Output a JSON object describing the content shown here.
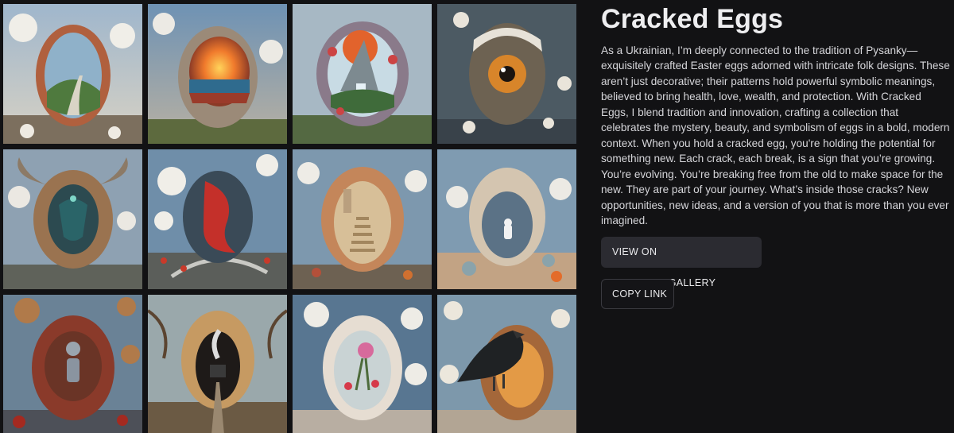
{
  "gallery": {
    "tiles": [
      {
        "icon": "egg-landscape-path-image"
      },
      {
        "icon": "egg-sunset-image"
      },
      {
        "icon": "egg-waterfall-image"
      },
      {
        "icon": "egg-eye-image"
      },
      {
        "icon": "egg-horned-bull-image"
      },
      {
        "icon": "egg-red-swirl-image"
      },
      {
        "icon": "egg-staircase-image"
      },
      {
        "icon": "egg-astronaut-image"
      },
      {
        "icon": "egg-figure-image"
      },
      {
        "icon": "egg-train-tunnel-image"
      },
      {
        "icon": "egg-orchid-image"
      },
      {
        "icon": "egg-crow-image"
      }
    ]
  },
  "info": {
    "title": "Cracked Eggs",
    "description": "As a Ukrainian, I’m deeply connected to the tradition of Pysanky—exquisitely crafted Easter eggs adorned with intricate folk designs. These aren’t just decorative; their patterns hold powerful symbolic meanings, believed to bring health, love, wealth, and protection. With Cracked Eggs, I blend tradition and innovation, crafting a collection that celebrates the mystery, beauty, and symbolism of eggs in a bold, modern context. When you hold a cracked egg, you're holding the potential for something new. Each crack, each break, is a sign that you’re growing. You’re evolving. You’re breaking free from the old to make space for the new. They are part of your journey. What’s inside those cracks? New opportunities, new ideas, and a version of you that is more than you ever imagined.",
    "view_button": "VIEW ON MANIFOLD.GALLERY",
    "copy_button": "COPY LINK"
  }
}
